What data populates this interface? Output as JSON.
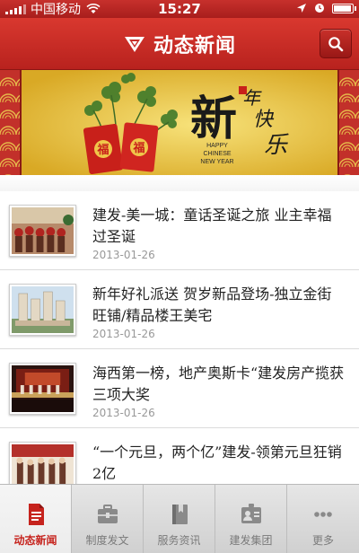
{
  "status_bar": {
    "carrier": "中国移动",
    "time": "15:27"
  },
  "header": {
    "title": "动态新闻"
  },
  "banner": {
    "lines": [
      "新",
      "年",
      "快",
      "乐"
    ],
    "english_line1": "HAPPY",
    "english_line2": "CHINESE",
    "english_line3": "NEW YEAR"
  },
  "news": [
    {
      "title": "建发-美一城：童话圣诞之旅 业主幸福过圣诞",
      "date": "2013-01-26"
    },
    {
      "title": "新年好礼派送 贺岁新品登场-独立金街旺铺/精品楼王美宅",
      "date": "2013-01-26"
    },
    {
      "title": "海西第一榜，地产奥斯卡“建发房产揽获三项大奖",
      "date": "2013-01-26"
    },
    {
      "title": "“一个元旦，两个亿”建发-领第元旦狂销2亿",
      "date": ""
    }
  ],
  "tabs": [
    {
      "label": "动态新闻",
      "icon": "document-icon",
      "active": true
    },
    {
      "label": "制度发文",
      "icon": "briefcase-icon",
      "active": false
    },
    {
      "label": "服务资讯",
      "icon": "book-icon",
      "active": false
    },
    {
      "label": "建发集团",
      "icon": "id-card-icon",
      "active": false
    },
    {
      "label": "更多",
      "icon": "more-icon",
      "active": false
    }
  ],
  "colors": {
    "brand_red": "#c6231d",
    "banner_gold": "#e8c243"
  }
}
